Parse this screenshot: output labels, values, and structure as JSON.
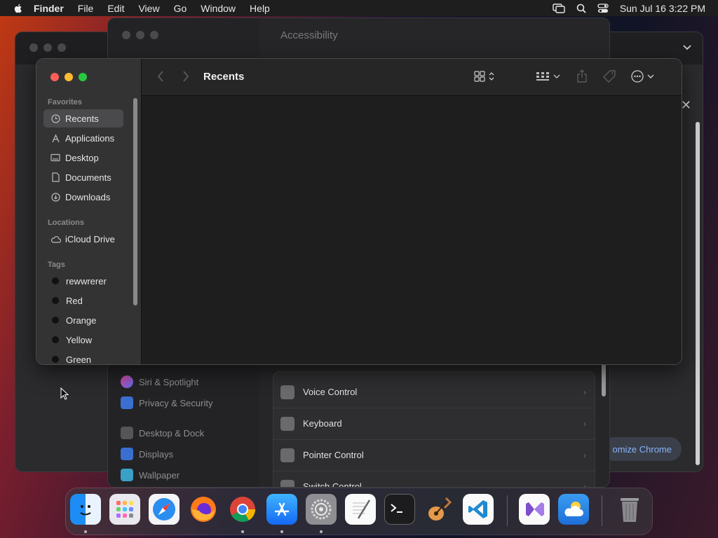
{
  "menubar": {
    "app_name": "Finder",
    "menus": [
      "File",
      "Edit",
      "View",
      "Go",
      "Window",
      "Help"
    ],
    "clock": "Sun Jul 16  3:22 PM"
  },
  "chrome": {
    "customize_label": "omize Chrome"
  },
  "settings": {
    "title": "Accessibility",
    "sidebar_items": [
      "Siri & Spotlight",
      "Privacy & Security",
      "Desktop & Dock",
      "Displays",
      "Wallpaper"
    ],
    "panel_rows": [
      "Voice Control",
      "Keyboard",
      "Pointer Control",
      "Switch Control"
    ]
  },
  "finder": {
    "title": "Recents",
    "sections": {
      "favorites": "Favorites",
      "locations": "Locations",
      "tags": "Tags"
    },
    "favorites": [
      "Recents",
      "Applications",
      "Desktop",
      "Documents",
      "Downloads"
    ],
    "locations": [
      "iCloud Drive"
    ],
    "tags": [
      "rewwrerer",
      "Red",
      "Orange",
      "Yellow",
      "Green"
    ]
  },
  "dock": {
    "apps": [
      "finder",
      "launchpad",
      "safari",
      "firefox",
      "chrome",
      "app-store",
      "system-settings",
      "textedit",
      "terminal",
      "garageband",
      "vscode",
      "visual-studio",
      "weather",
      "trash"
    ]
  },
  "colors": {
    "close": "#ff5f57",
    "minimize": "#febc2e",
    "zoom": "#28c840",
    "chrome_link": "#8ab4f8"
  }
}
